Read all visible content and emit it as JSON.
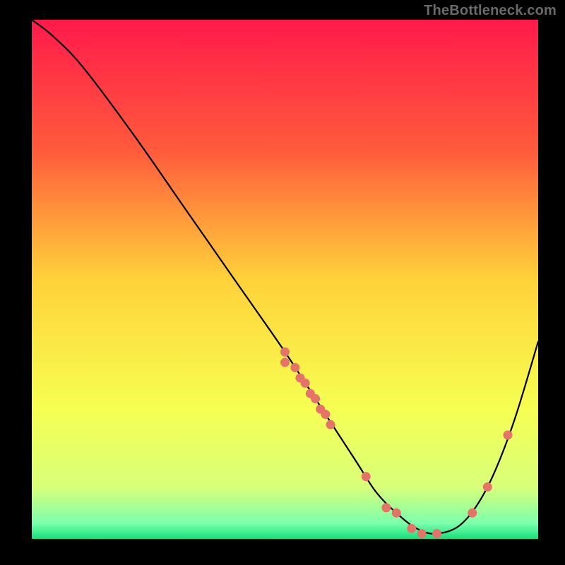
{
  "watermark": "TheBottleneck.com",
  "chart_data": {
    "type": "line",
    "title": "",
    "xlabel": "",
    "ylabel": "",
    "xlim": [
      0,
      100
    ],
    "ylim": [
      0,
      100
    ],
    "gradient_stops": [
      {
        "offset": 0,
        "color": "#ff1a4b"
      },
      {
        "offset": 25,
        "color": "#ff5a3c"
      },
      {
        "offset": 50,
        "color": "#ffd23a"
      },
      {
        "offset": 75,
        "color": "#f6ff52"
      },
      {
        "offset": 90,
        "color": "#d8ff7a"
      },
      {
        "offset": 97,
        "color": "#7cffab"
      },
      {
        "offset": 100,
        "color": "#13e07a"
      }
    ],
    "series": [
      {
        "name": "curve",
        "x": [
          0,
          4,
          10,
          20,
          30,
          40,
          50,
          58,
          64,
          68,
          72,
          76,
          80,
          85,
          90,
          95,
          100
        ],
        "y": [
          100,
          97,
          91,
          78,
          64,
          50,
          36,
          24,
          15,
          9,
          5,
          2,
          1,
          3,
          10,
          22,
          38
        ]
      }
    ],
    "scatter": {
      "name": "points",
      "color": "#e57368",
      "radius": 6.5,
      "x": [
        50,
        50,
        52,
        53,
        54,
        55,
        56,
        57,
        58,
        59,
        66,
        70,
        72,
        75,
        77,
        80,
        87,
        90,
        94
      ],
      "y": [
        36,
        34,
        33,
        31,
        30,
        28,
        27,
        25,
        24,
        22,
        12,
        6,
        5,
        2,
        1,
        1,
        5,
        10,
        20
      ]
    }
  }
}
